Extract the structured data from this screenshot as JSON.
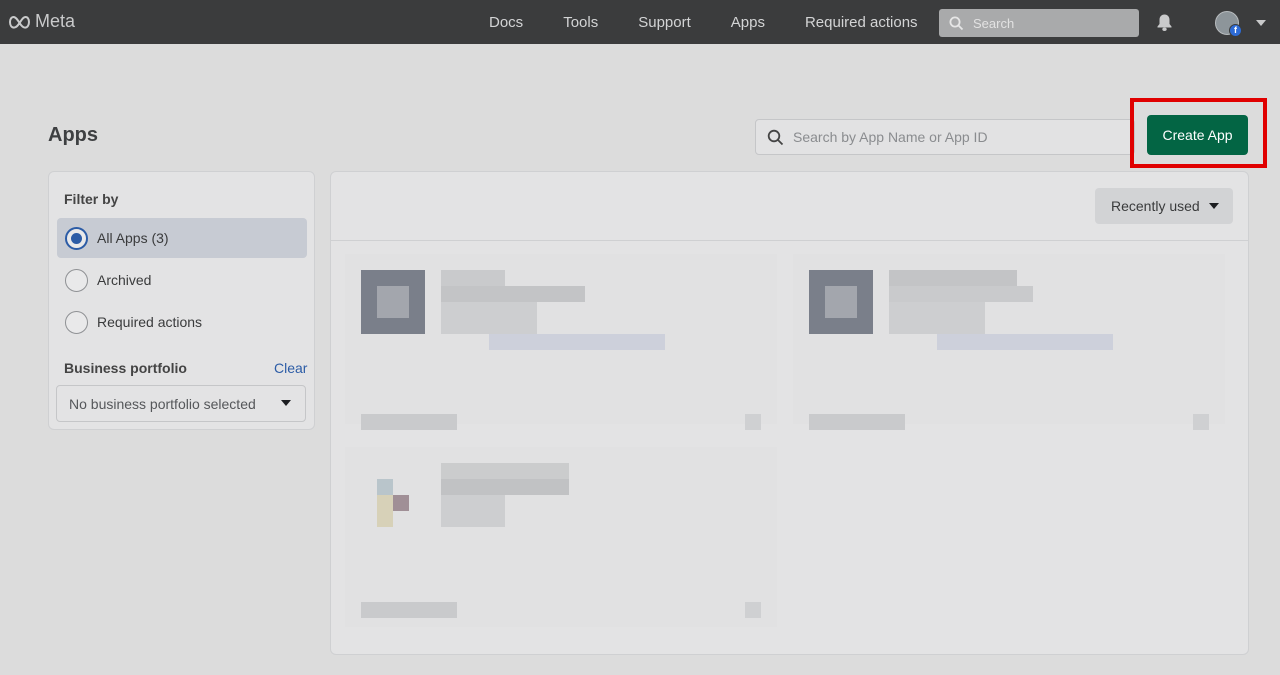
{
  "topnav": {
    "brand": "Meta",
    "links": [
      "Docs",
      "Tools",
      "Support",
      "Apps",
      "Required actions"
    ],
    "search_placeholder": "Search"
  },
  "page": {
    "title": "Apps",
    "search_placeholder": "Search by App Name or App ID",
    "create_button": "Create App"
  },
  "filter": {
    "heading": "Filter by",
    "options": [
      {
        "label": "All Apps (3)",
        "selected": true
      },
      {
        "label": "Archived",
        "selected": false
      },
      {
        "label": "Required actions",
        "selected": false
      }
    ],
    "business_portfolio_heading": "Business portfolio",
    "clear_label": "Clear",
    "business_portfolio_value": "No business portfolio selected"
  },
  "main": {
    "sort_label": "Recently used",
    "app_cards_count": 3
  },
  "colors": {
    "topnav_bg": "#3b3c3d",
    "primary_button": "#036544",
    "highlight_box": "#e00000",
    "link": "#2c5ca6"
  }
}
